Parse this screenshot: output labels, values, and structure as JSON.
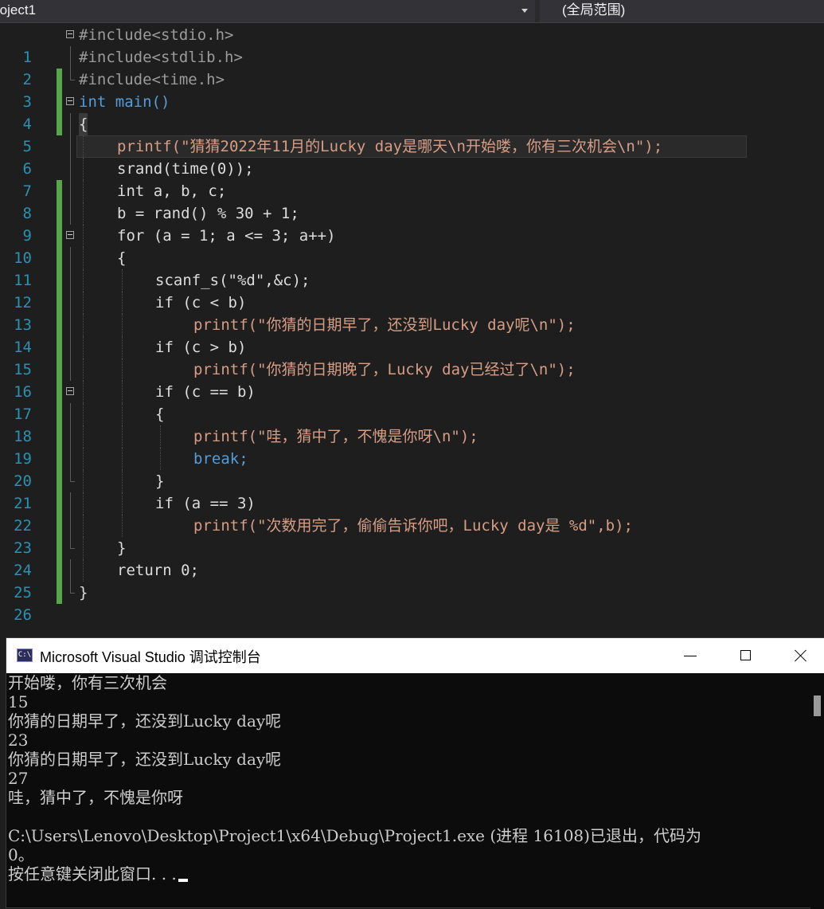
{
  "nav": {
    "project_label": "roject1",
    "scope_label": "(全局范围)"
  },
  "editor": {
    "line_numbers": [
      "1",
      "2",
      "3",
      "4",
      "5",
      "6",
      "7",
      "8",
      "9",
      "10",
      "11",
      "12",
      "13",
      "14",
      "15",
      "16",
      "17",
      "18",
      "19",
      "20",
      "21",
      "22",
      "23",
      "24",
      "25",
      "26"
    ],
    "lines": [
      "#include<stdio.h>",
      "#include<stdlib.h>",
      "#include<time.h>",
      "int main()",
      "{",
      "printf(\"猜猜2022年11月的Lucky day是哪天\\n开始喽，你有三次机会\\n\");",
      "srand(time(0));",
      "int a, b, c;",
      "b = rand() % 30 + 1;",
      "for (a = 1; a <= 3; a++)",
      "{",
      "scanf_s(\"%d\",&c);",
      "if (c < b)",
      "printf(\"你猜的日期早了，还没到Lucky day呢\\n\");",
      "if (c > b)",
      "printf(\"你猜的日期晚了，Lucky day已经过了\\n\");",
      "if (c == b)",
      "{",
      "printf(\"哇，猜中了，不愧是你呀\\n\");",
      "break;",
      "}",
      "if (a == 3)",
      "printf(\"次数用完了，偷偷告诉你吧，Lucky day是 %d\",b);",
      "}",
      "return 0;",
      "}"
    ]
  },
  "console": {
    "title": "Microsoft Visual Studio 调试控制台",
    "icon_label": "C:\\",
    "output": [
      "开始喽，你有三次机会",
      "15",
      "你猜的日期早了，还没到Lucky day呢",
      "23",
      "你猜的日期早了，还没到Lucky day呢",
      "27",
      "哇，猜中了，不愧是你呀",
      "",
      "C:\\Users\\Lenovo\\Desktop\\Project1\\x64\\Debug\\Project1.exe (进程 16108)已退出，代码为",
      "0。",
      "按任意键关闭此窗口. . ."
    ]
  },
  "colors": {
    "keyword": "#569cd6",
    "string": "#d69d85",
    "line_number": "#2b91af",
    "change_marker": "#57a64a",
    "console_bg": "#0c0c0c"
  }
}
